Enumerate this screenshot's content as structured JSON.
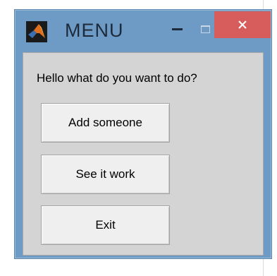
{
  "window": {
    "title": "MENU",
    "icon": "matlab-logo-icon",
    "controls": [
      "minimize-icon",
      "maximize-icon",
      "close-icon"
    ],
    "close_color": "#d65d5c",
    "frame_color": "#6e9bc6"
  },
  "content": {
    "prompt": "Hello what do you want to do?",
    "buttons": {
      "add": "Add someone",
      "see": "See it work",
      "exit": "Exit"
    }
  }
}
